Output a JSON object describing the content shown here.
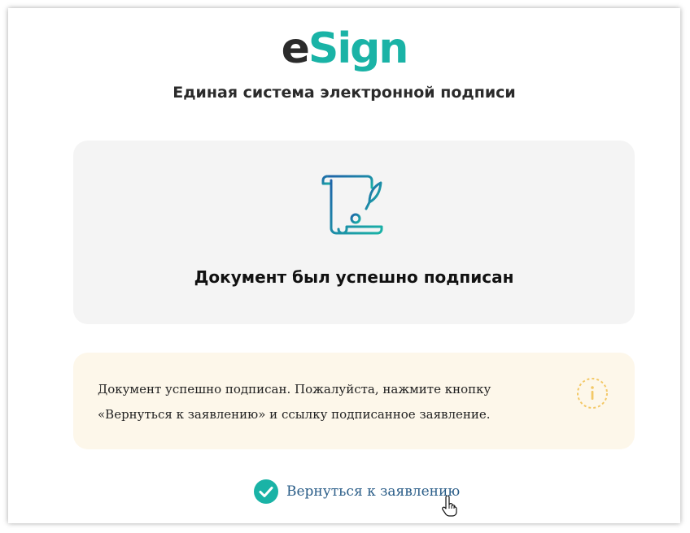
{
  "brand": {
    "logo_e": "e",
    "logo_sign": "Sign",
    "subtitle": "Единая система электронной подписи"
  },
  "status_card": {
    "icon": "signed-document-icon",
    "title": "Документ был успешно подписан"
  },
  "notice": {
    "text": "Документ успешно подписан. Пожалуйста, нажмите кнопку «Вернуться к заявлению» и ссылку подписанное заявление.",
    "icon": "info-icon"
  },
  "actions": {
    "back_label": "Вернуться к заявлению",
    "back_icon": "check-circle-icon"
  },
  "colors": {
    "brand_dark": "#2b2b2b",
    "brand_accent": "#1ab3a6",
    "link": "#2a5d88",
    "card_bg": "#f4f4f4",
    "notice_bg": "#fdf7ea",
    "info_accent": "#f3c866"
  }
}
